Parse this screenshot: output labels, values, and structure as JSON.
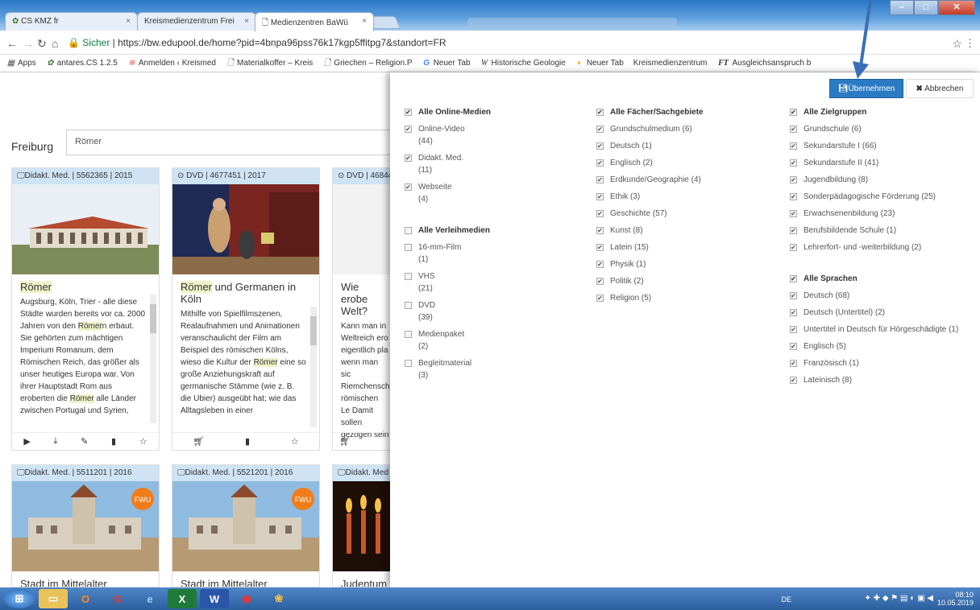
{
  "browser": {
    "tabs": [
      {
        "label": "CS KMZ fr"
      },
      {
        "label": "Kreismedienzentrum Frei"
      },
      {
        "label": "Medienzentren BaWü"
      }
    ],
    "url_secure": "Sicher",
    "url_text": "https://bw.edupool.de/home?pid=4bnpa96pss76k17kgp5ffitpg7&standort=FR",
    "bookmarks": [
      "Apps",
      "antares.CS 1.2.5",
      "Anmelden ‹ Kreismed",
      "Materialkoffer – Kreis",
      "Griechen – Religion.P",
      "Neuer Tab",
      "Historische Geologie",
      "Neuer Tab",
      "Kreismedienzentrum",
      "Ausgleichsanspruch b"
    ]
  },
  "page": {
    "location": "Freiburg",
    "search_value": "Römer",
    "cards": [
      {
        "header": "Didakt. Med. | 5562365 | 2015",
        "title_hl": "Römer",
        "title_rest": "",
        "desc_parts": [
          "Augsburg, Köln, Trier - alle diese Städte wurden bereits vor ca. 2000 Jahren von den ",
          "Römer",
          "n erbaut. Sie gehörten zum mächtigen Imperium Romanum, dem Römischen Reich, das größer als unser heutiges Europa war. Von ihrer Hauptstadt Rom aus eroberten die ",
          "Römer",
          " alle Länder zwischen Portugal und Syrien,"
        ]
      },
      {
        "header": "DVD | 4677451 | 2017",
        "title_hl": "Römer",
        "title_rest": " und Germanen in Köln",
        "desc_parts": [
          "Mithilfe von Spielfilmszenen, Realaufnahmen und Animationen veranschaulicht der Film am Beispiel des römischen Kölns, wieso die Kultur der ",
          "Römer",
          " eine so große Anziehungskraft auf germanische Stämme (wie z. B. die Ubier) ausgeübt hat; wie das Alltagsleben in einer",
          "",
          ""
        ]
      },
      {
        "header": "DVD | 46844",
        "title_hl": "",
        "title_rest": "Wie erobe Welt?",
        "desc_parts": [
          "Kann man in Weltreich ero eigentlich pla wenn man sic Riemchensch römischen Le Damit sollen gezogen sein Wälder und S hunderte, ja t",
          "",
          "",
          "",
          ""
        ]
      },
      {
        "header": "Didakt. Med. | 5511201 | 2016",
        "title": "Stadt im Mittelalter"
      },
      {
        "header": "Didakt. Med. | 5521201 | 2016",
        "title": "Stadt im Mittelalter (interaktiv)"
      },
      {
        "header": "Didakt. Med",
        "title": "Judentum"
      }
    ],
    "badge": "FWU"
  },
  "filter": {
    "apply_label": "Übernehmen",
    "cancel_label": "Abbrechen",
    "col1": {
      "online_title": "Alle Online-Medien",
      "online": [
        {
          "label": "Online-Video",
          "count": "(44)"
        },
        {
          "label": "Didakt. Med.",
          "count": "(11)"
        },
        {
          "label": "Webseite",
          "count": "(4)"
        }
      ],
      "lend_title": "Alle Verleihmedien",
      "lend": [
        {
          "label": "16-mm-Film",
          "count": "(1)"
        },
        {
          "label": "VHS",
          "count": "(21)"
        },
        {
          "label": "DVD",
          "count": "(39)"
        },
        {
          "label": "Medienpaket",
          "count": "(2)"
        },
        {
          "label": "Begleitmaterial",
          "count": "(3)"
        }
      ]
    },
    "col2": {
      "title": "Alle Fächer/Sachgebiete",
      "items": [
        "Grundschulmedium (6)",
        "Deutsch (1)",
        "Englisch (2)",
        "Erdkunde/Geographie (4)",
        "Ethik (3)",
        "Geschichte (57)",
        "Kunst (8)",
        "Latein (15)",
        "Physik (1)",
        "Politik (2)",
        "Religion (5)"
      ]
    },
    "col3": {
      "title": "Alle Zielgruppen",
      "items": [
        "Grundschule (6)",
        "Sekundarstufe I (66)",
        "Sekundarstufe II (41)",
        "Jugendbildung (8)",
        "Sonderpädagogische Förderung (25)",
        "Erwachsenenbildung (23)",
        "Berufsbildende Schule (1)",
        "Lehrerfort- und -weiterbildung (2)"
      ],
      "lang_title": "Alle Sprachen",
      "langs": [
        "Deutsch (68)",
        "Deutsch (Untertitel) (2)",
        "Untertitel in Deutsch für Hörgeschädigte (1)",
        "Englisch (5)",
        "Französisch (1)",
        "Lateinisch (8)"
      ]
    }
  },
  "taskbar": {
    "time": "08:10",
    "date": "10.05.2019",
    "lang": "DE"
  },
  "colors": {
    "primary": "#2b7bc4",
    "card_header": "#cfe3f5",
    "highlight": "#eef3c9",
    "arrow": "#3a6fb8"
  }
}
